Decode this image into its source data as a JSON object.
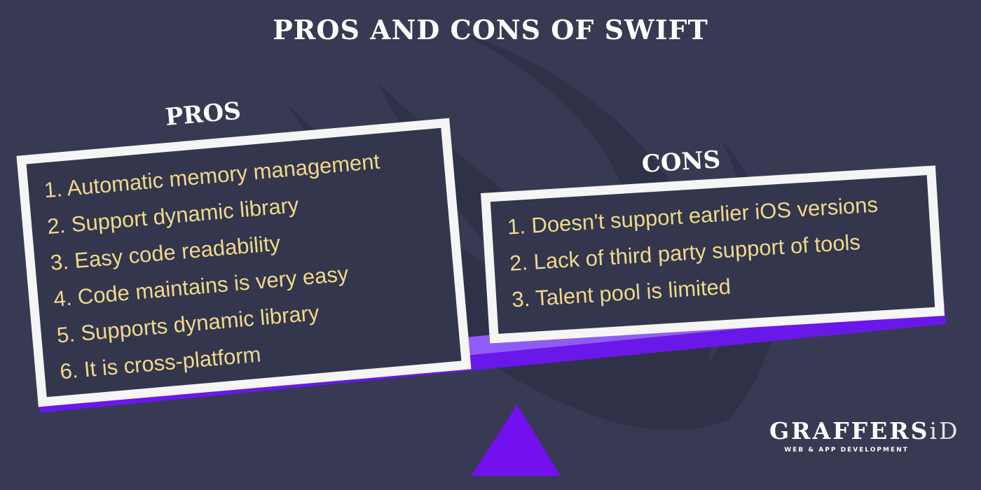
{
  "title": "PROS AND CONS OF SWIFT",
  "pros": {
    "label": "PROS",
    "items": [
      "1. Automatic memory management",
      "2.  Support dynamic library",
      "3.  Easy code readability",
      "4. Code maintains is very easy",
      "5. Supports dynamic library",
      "6.  It is cross-platform"
    ]
  },
  "cons": {
    "label": "CONS",
    "items": [
      "1. Doesn't support earlier iOS versions",
      "2.  Lack of third party support of tools",
      "3. Talent pool is limited"
    ]
  },
  "logo": {
    "word": "GRAFFERS",
    "suffix": "iD",
    "tagline": "WEB & APP DEVELOPMENT"
  },
  "colors": {
    "background": "#373a52",
    "card_border": "#f5f5f5",
    "item_text": "#f0d98a",
    "beam_top": "#8f5cf6",
    "beam_bottom": "#6a18ea",
    "fulcrum": "#7210f0"
  },
  "icons": {
    "background": "swift-logo-icon",
    "fulcrum": "triangle-fulcrum-icon"
  }
}
